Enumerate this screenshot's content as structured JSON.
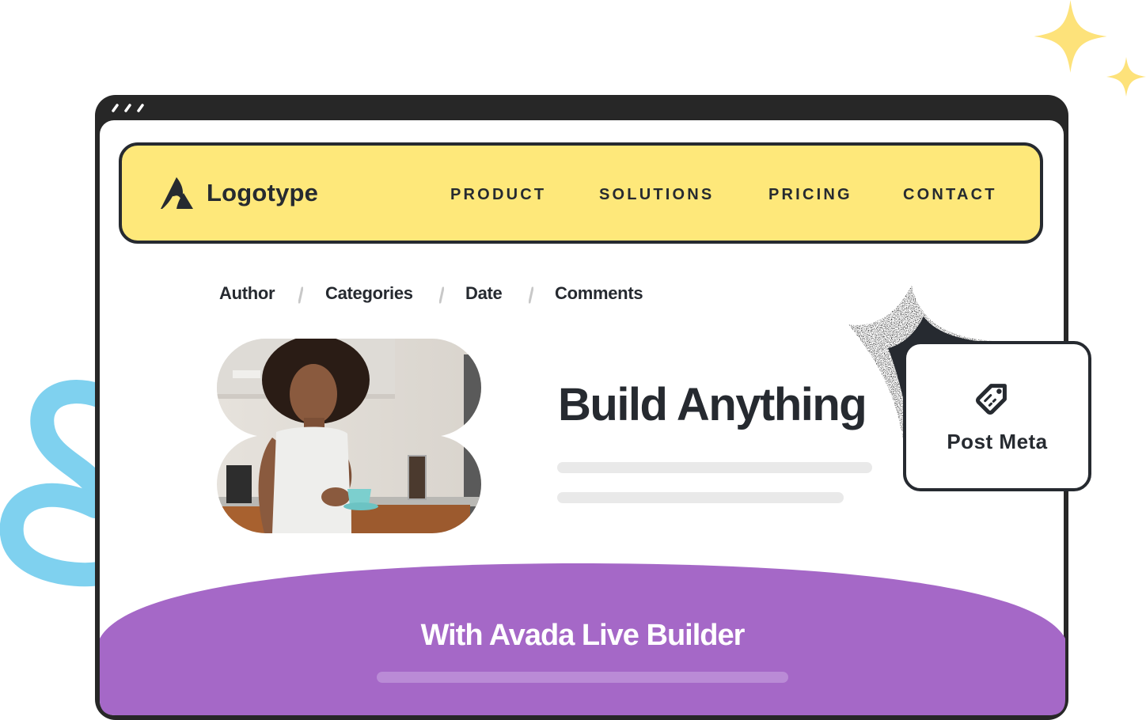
{
  "colors": {
    "frame": "#272727",
    "ink": "#262a30",
    "navbar_bg": "#fee87a",
    "sparkle": "#fde27a",
    "squiggle": "#7fd1ef",
    "purple": "#a568c7",
    "purple_bar": "#ba8bd6",
    "placeholder_line": "#e9e9e9"
  },
  "window": {
    "controls": [
      "dot",
      "dot",
      "dot"
    ]
  },
  "navbar": {
    "logo_icon": "logo-mark-icon",
    "logo_text": "Logotype",
    "items": [
      {
        "label": "PRODUCT"
      },
      {
        "label": "SOLUTIONS"
      },
      {
        "label": "PRICING"
      },
      {
        "label": "CONTACT"
      }
    ]
  },
  "post_meta_row": {
    "items": [
      {
        "label": "Author"
      },
      {
        "label": "Categories"
      },
      {
        "label": "Date"
      },
      {
        "label": "Comments"
      }
    ],
    "separator": "/"
  },
  "hero": {
    "image_alt": "Woman holding a teal cup in a kitchen",
    "headline": "Build Anything"
  },
  "feature_card": {
    "icon": "tag-icon",
    "label": "Post Meta"
  },
  "footer_banner": {
    "text": "With Avada Live Builder"
  }
}
